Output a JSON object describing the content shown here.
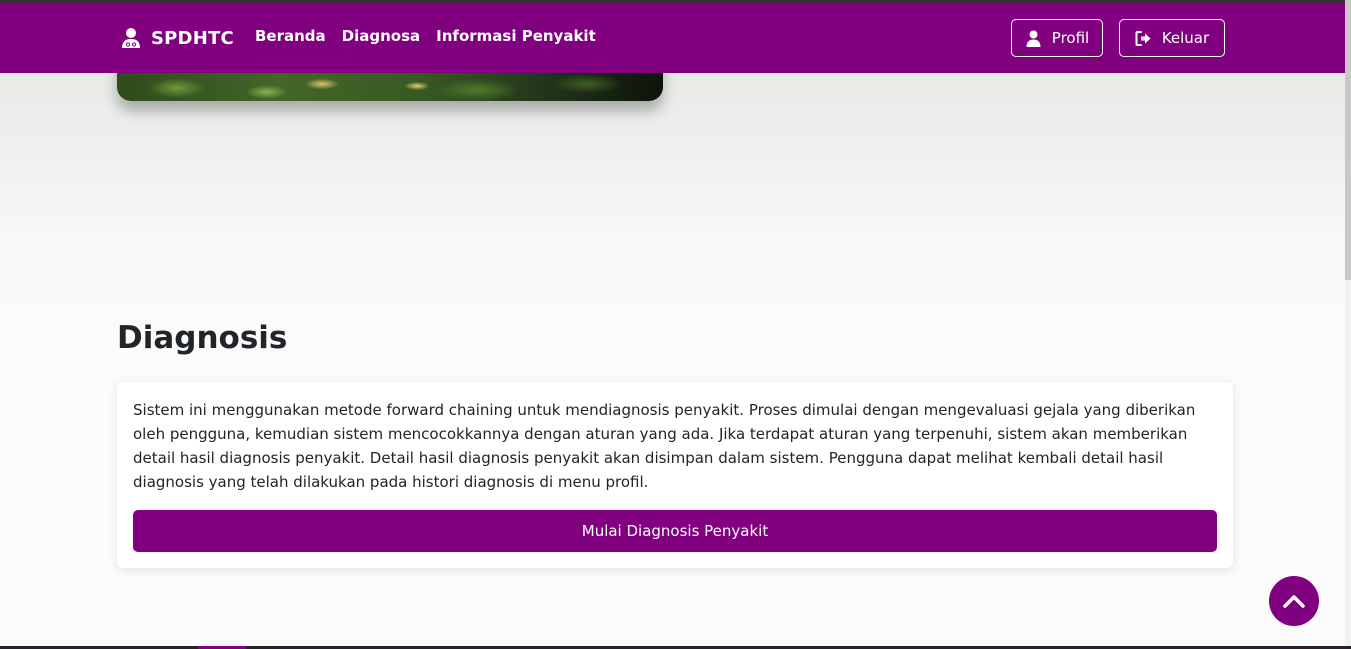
{
  "navbar": {
    "brand": "SPDHTC",
    "brand_icon": "user-doctor-icon",
    "links": [
      {
        "label": "Beranda"
      },
      {
        "label": "Diagnosa"
      },
      {
        "label": "Informasi Penyakit"
      }
    ],
    "profile_button": {
      "label": "Profil",
      "icon": "user-icon"
    },
    "logout_button": {
      "label": "Keluar",
      "icon": "sign-out-icon"
    }
  },
  "hero": {
    "image": "plant-leaves-photo"
  },
  "diagnosis": {
    "title": "Diagnosis",
    "description": "Sistem ini menggunakan metode forward chaining untuk mendiagnosis penyakit. Proses dimulai dengan mengevaluasi gejala yang diberikan oleh pengguna, kemudian sistem mencocokkannya dengan aturan yang ada. Jika terdapat aturan yang terpenuhi, sistem akan memberikan detail hasil diagnosis penyakit. Detail hasil diagnosis penyakit akan disimpan dalam sistem. Pengguna dapat melihat kembali detail hasil diagnosis yang telah dilakukan pada histori diagnosis di menu profil.",
    "button": "Mulai Diagnosis Penyakit"
  },
  "scroll_top": {
    "icon": "chevron-up-icon"
  },
  "colors": {
    "primary": "#800080",
    "text": "#212529",
    "background": "#fbfbfb"
  }
}
